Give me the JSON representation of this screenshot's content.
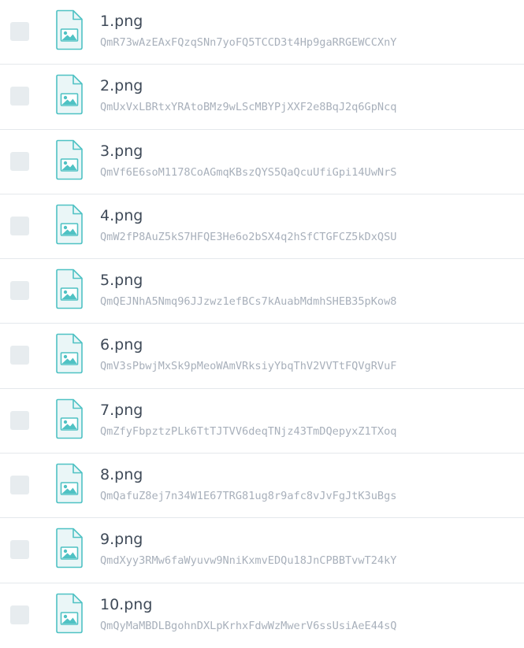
{
  "colors": {
    "icon_accent": "#4fc2c4",
    "icon_fill": "#eaf6f7",
    "checkbox": "#e7ecef",
    "name_text": "#3f4a58",
    "hash_text": "#a8b0bb",
    "divider": "#e4e8ec"
  },
  "files": [
    {
      "name": "1.png",
      "hash": "QmR73wAzEAxFQzqSNn7yoFQ5TCCD3t4Hp9gaRRGEWCCXnY",
      "icon": "image-file-icon",
      "checked": false
    },
    {
      "name": "2.png",
      "hash": "QmUxVxLBRtxYRAtoBMz9wLScMBYPjXXF2e8BqJ2q6GpNcq",
      "icon": "image-file-icon",
      "checked": false
    },
    {
      "name": "3.png",
      "hash": "QmVf6E6soM1178CoAGmqKBszQYS5QaQcuUfiGpi14UwNrS",
      "icon": "image-file-icon",
      "checked": false
    },
    {
      "name": "4.png",
      "hash": "QmW2fP8AuZ5kS7HFQE3He6o2bSX4q2hSfCTGFCZ5kDxQSU",
      "icon": "image-file-icon",
      "checked": false
    },
    {
      "name": "5.png",
      "hash": "QmQEJNhA5Nmq96JJzwz1efBCs7kAuabMdmhSHEB35pKow8",
      "icon": "image-file-icon",
      "checked": false
    },
    {
      "name": "6.png",
      "hash": "QmV3sPbwjMxSk9pMeoWAmVRksiyYbqThV2VVTtFQVgRVuF",
      "icon": "image-file-icon",
      "checked": false
    },
    {
      "name": "7.png",
      "hash": "QmZfyFbpztzPLk6TtTJTVV6deqTNjz43TmDQepyxZ1TXoq",
      "icon": "image-file-icon",
      "checked": false
    },
    {
      "name": "8.png",
      "hash": "QmQafuZ8ej7n34W1E67TRG81ug8r9afc8vJvFgJtK3uBgs",
      "icon": "image-file-icon",
      "checked": false
    },
    {
      "name": "9.png",
      "hash": "QmdXyy3RMw6faWyuvw9NniKxmvEDQu18JnCPBBTvwT24kY",
      "icon": "image-file-icon",
      "checked": false
    },
    {
      "name": "10.png",
      "hash": "QmQyMaMBDLBgohnDXLpKrhxFdwWzMwerV6ssUsiAeE44sQ",
      "icon": "image-file-icon",
      "checked": false
    }
  ]
}
